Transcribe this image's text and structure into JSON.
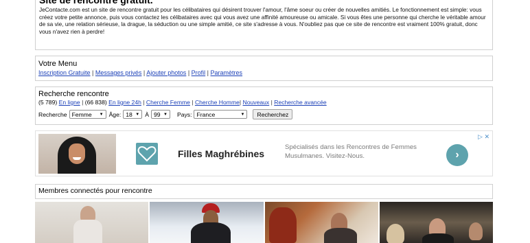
{
  "intro": {
    "title": "Site de rencontre gratuit.",
    "text": "JeContacte.com est un site de rencontre gratuit pour les célibataires qui désirent trouver l'amour, l'âme soeur ou créer de nouvelles amitiés. Le fonctionnement est simple: vous créez votre petite annonce, puis vous contactez les célibataires avec qui vous avez une affinité amoureuse ou amicale. Si vous êtes une personne qui cherche le véritable amour de sa vie, une relation sérieuse, la drague, la séduction ou une simple amitié, ce site s'adresse à vous. N'oubliez pas que ce site de rencontre est vraiment 100% gratuit, donc vous n'avez rien à perdre!"
  },
  "menu": {
    "title": "Votre Menu",
    "links": [
      "Inscription Gratuite",
      "Messages privés",
      "Ajouter photos",
      "Profil",
      "Paramètres"
    ]
  },
  "search": {
    "title": "Recherche rencontre",
    "online_count": "(5 789)",
    "online_link": "En ligne",
    "online24_count": "(66 838)",
    "online24_link": "En ligne 24h",
    "seek_woman": "Cherche Femme",
    "seek_man": "Cherche Homme",
    "new_link": "Nouveaux",
    "advanced_link": "Recherche avancée",
    "recherche_label": "Recherche",
    "gender_value": "Femme",
    "age_label": "Âge:",
    "age_from": "18",
    "age_to_label": "À",
    "age_to": "99",
    "country_label": "Pays:",
    "country_value": "France",
    "submit_label": "Recherchez"
  },
  "ad": {
    "headline": "Filles Maghrébines",
    "description": "Spécialisés dans les Rencontres de Femmes Musulmanes. Visitez-Nous.",
    "cta": "›",
    "adchoices": "▷ ✕",
    "logo_color": "#5ea3ad"
  },
  "members": {
    "title": "Membres connectés pour rencontre"
  }
}
